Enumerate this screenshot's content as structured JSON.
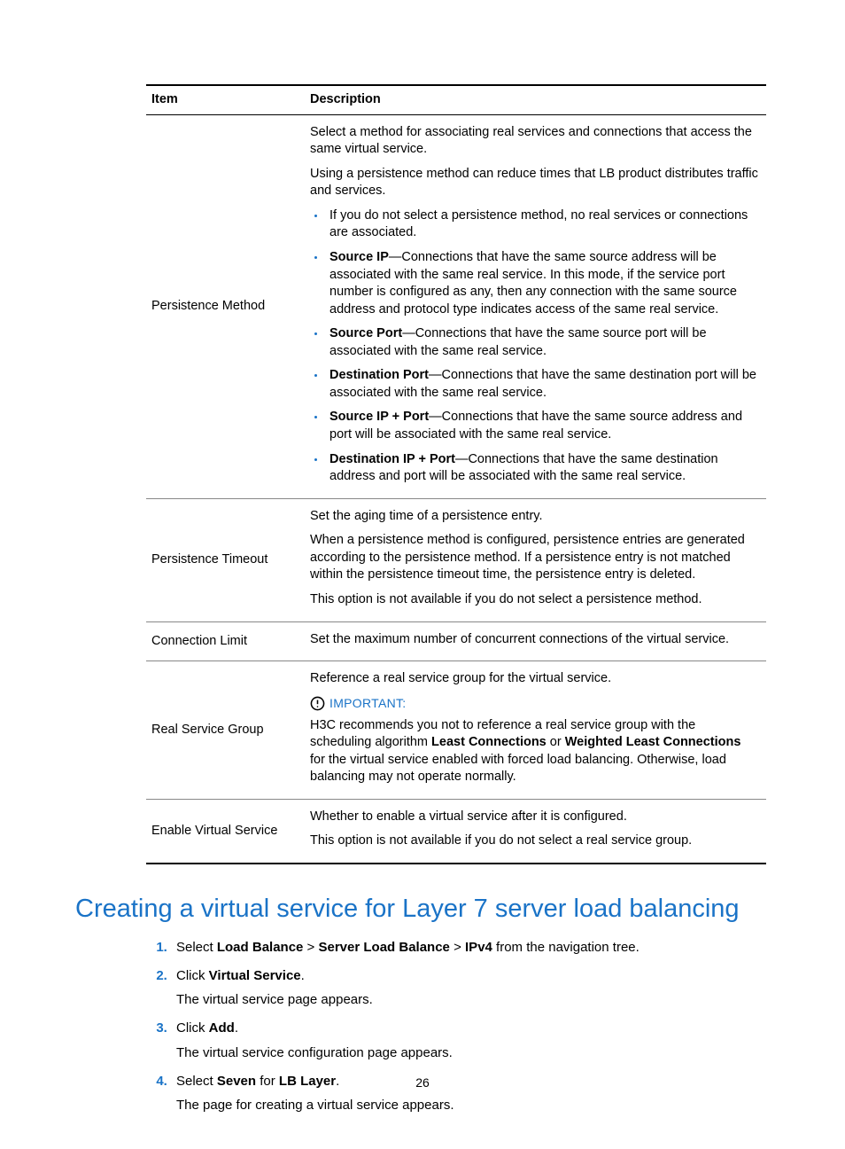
{
  "table": {
    "headers": {
      "item": "Item",
      "description": "Description"
    },
    "rows": {
      "persistence_method": {
        "item": "Persistence Method",
        "p1": "Select a method for associating real services and connections that access the same virtual service.",
        "p2": "Using a persistence method can reduce times that LB product distributes traffic and services.",
        "b1": "If you do not select a persistence method, no real services or connections are associated.",
        "b2_lead": "Source IP",
        "b2_rest": "—Connections that have the same source address will be associated with the same real service. In this mode, if the service port number is configured as any, then any connection with the same source address and protocol type indicates access of the same real service.",
        "b3_lead": "Source Port",
        "b3_rest": "—Connections that have the same source port will be associated with the same real service.",
        "b4_lead": "Destination Port",
        "b4_rest": "—Connections that have the same destination port will be associated with the same real service.",
        "b5_lead": "Source IP + Port",
        "b5_rest": "—Connections that have the same source address and port will be associated with the same real service.",
        "b6_lead": "Destination IP + Port",
        "b6_rest": "—Connections that have the same destination address and port will be associated with the same real service."
      },
      "persistence_timeout": {
        "item": "Persistence Timeout",
        "p1": "Set the aging time of a persistence entry.",
        "p2": "When a persistence method is configured, persistence entries are generated according to the persistence method. If a persistence entry is not matched within the persistence timeout time, the persistence entry is deleted.",
        "p3": "This option is not available if you do not select a persistence method."
      },
      "connection_limit": {
        "item": "Connection Limit",
        "p1": "Set the maximum number of concurrent connections of the virtual service."
      },
      "real_service_group": {
        "item": "Real Service Group",
        "p1": "Reference a real service group for the virtual service.",
        "important_label": "IMPORTANT:",
        "p2a": "H3C recommends you not to reference a real service group with the scheduling algorithm ",
        "p2b1": "Least Connections",
        "p2c": " or ",
        "p2b2": "Weighted Least Connections",
        "p2d": " for the virtual service enabled with forced load balancing. Otherwise, load balancing may not operate normally."
      },
      "enable_virtual_service": {
        "item": "Enable Virtual Service",
        "p1": "Whether to enable a virtual service after it is configured.",
        "p2": "This option is not available if you do not select a real service group."
      }
    }
  },
  "heading": "Creating a virtual service for Layer 7 server load balancing",
  "steps": {
    "s1a": "Select ",
    "s1b1": "Load Balance",
    "s1sep1": " > ",
    "s1b2": "Server Load Balance",
    "s1sep2": " > ",
    "s1b3": "IPv4",
    "s1c": " from the navigation tree.",
    "s2a": "Click ",
    "s2b": "Virtual Service",
    "s2c": ".",
    "s2p": "The virtual service page appears.",
    "s3a": "Click ",
    "s3b": "Add",
    "s3c": ".",
    "s3p": "The virtual service configuration page appears.",
    "s4a": "Select ",
    "s4b1": "Seven",
    "s4c": " for ",
    "s4b2": "LB Layer",
    "s4d": ".",
    "s4p": "The page for creating a virtual service appears."
  },
  "page_number": "26"
}
